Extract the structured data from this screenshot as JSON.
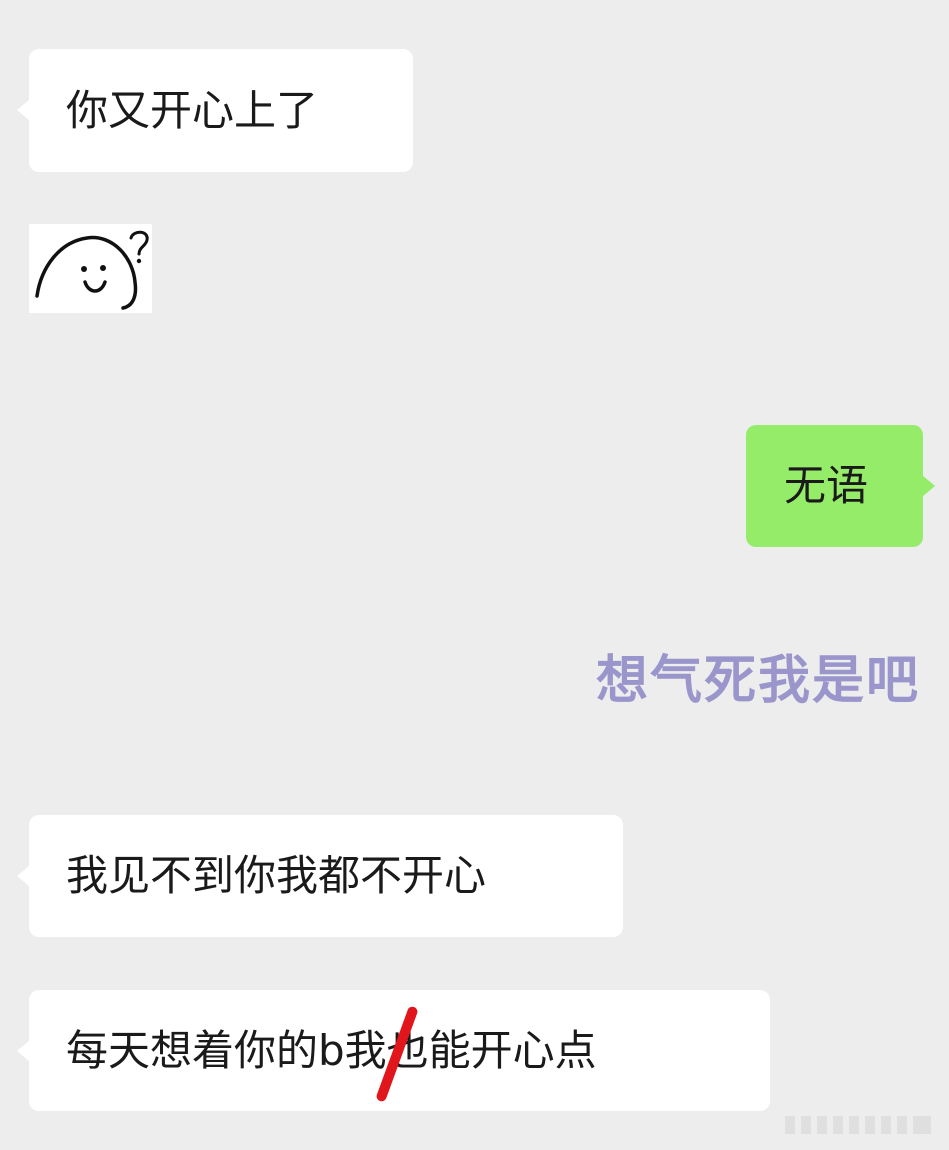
{
  "chat": {
    "messages": [
      {
        "side": "left",
        "type": "text",
        "text": "你又开心上了"
      },
      {
        "side": "left",
        "type": "sticker",
        "sticker": "smiling-blob-question"
      },
      {
        "side": "right",
        "type": "text",
        "text": "无语"
      },
      {
        "side": "right",
        "type": "sticker-text",
        "text": "想气死我是吧"
      },
      {
        "side": "left",
        "type": "text",
        "text": "我见不到你我都不开心"
      },
      {
        "side": "left",
        "type": "text",
        "text": "每天想着你的b我也能开心点"
      }
    ]
  },
  "colors": {
    "background": "#ededed",
    "incoming_bubble": "#ffffff",
    "outgoing_bubble": "#95ec69",
    "sticker_text": "#9a96cc",
    "strike_mark": "#e0161c"
  }
}
